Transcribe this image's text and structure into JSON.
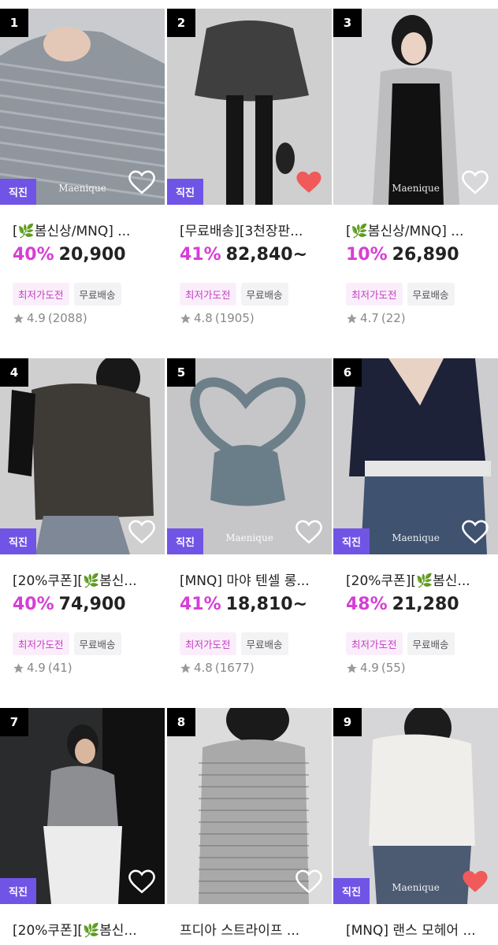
{
  "colors": {
    "badge": "#7054e6",
    "discount": "#d63ed6",
    "heart_active": "#f05a5a"
  },
  "products": [
    {
      "rank": "1",
      "badge": "직진",
      "watermark": "Maenique",
      "title": "[🌿봄신상/MNQ] ...",
      "discount": "40%",
      "price": "20,900",
      "tags": [
        "최저가도전",
        "무료배송"
      ],
      "rating": "4.9",
      "reviews": "(2088)",
      "liked": false
    },
    {
      "rank": "2",
      "badge": "직진",
      "watermark": "",
      "title": "[무료배송][3천장판...",
      "discount": "41%",
      "price": "82,840~",
      "tags": [
        "최저가도전",
        "무료배송"
      ],
      "rating": "4.8",
      "reviews": "(1905)",
      "liked": true
    },
    {
      "rank": "3",
      "badge": "",
      "watermark": "Maenique",
      "title": "[🌿봄신상/MNQ] ...",
      "discount": "10%",
      "price": "26,890",
      "tags": [
        "최저가도전",
        "무료배송"
      ],
      "rating": "4.7",
      "reviews": "(22)",
      "liked": false
    },
    {
      "rank": "4",
      "badge": "직진",
      "watermark": "",
      "title": "[20%쿠폰][🌿봄신...",
      "discount": "40%",
      "price": "74,900",
      "tags": [
        "최저가도전",
        "무료배송"
      ],
      "rating": "4.9",
      "reviews": "(41)",
      "liked": false
    },
    {
      "rank": "5",
      "badge": "직진",
      "watermark": "Maenique",
      "title": "[MNQ] 마야 텐셀 롱...",
      "discount": "41%",
      "price": "18,810~",
      "tags": [
        "최저가도전",
        "무료배송"
      ],
      "rating": "4.8",
      "reviews": "(1677)",
      "liked": false
    },
    {
      "rank": "6",
      "badge": "직진",
      "watermark": "Maenique",
      "title": "[20%쿠폰][🌿봄신...",
      "discount": "48%",
      "price": "21,280",
      "tags": [
        "최저가도전",
        "무료배송"
      ],
      "rating": "4.9",
      "reviews": "(55)",
      "liked": false
    },
    {
      "rank": "7",
      "badge": "직진",
      "watermark": "",
      "title": "[20%쿠폰][🌿봄신...",
      "discount": "",
      "price": "",
      "tags": [],
      "rating": "",
      "reviews": "",
      "liked": false
    },
    {
      "rank": "8",
      "badge": "",
      "watermark": "",
      "title": "프디아 스트라이프 ...",
      "discount": "",
      "price": "",
      "tags": [],
      "rating": "",
      "reviews": "",
      "liked": false
    },
    {
      "rank": "9",
      "badge": "직진",
      "watermark": "Maenique",
      "title": "[MNQ] 랜스 모헤어 ...",
      "discount": "",
      "price": "",
      "tags": [],
      "rating": "",
      "reviews": "",
      "liked": true
    }
  ]
}
